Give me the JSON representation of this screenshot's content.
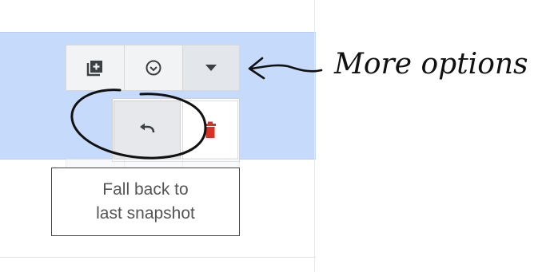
{
  "snapshot_row": {
    "toolbar": {
      "add_snapshot_icon": "add-box-icon",
      "check_icon": "check-circle-icon",
      "more_icon": "caret-down-icon"
    },
    "more_options_menu": {
      "revert_icon": "undo-icon",
      "delete_icon": "trash-icon",
      "delete_color": "#d93025"
    },
    "highlight_color": "#c6dafc"
  },
  "tooltip": {
    "line1": "Fall back to",
    "line2": "last snapshot"
  },
  "annotation": {
    "label": "More options"
  }
}
